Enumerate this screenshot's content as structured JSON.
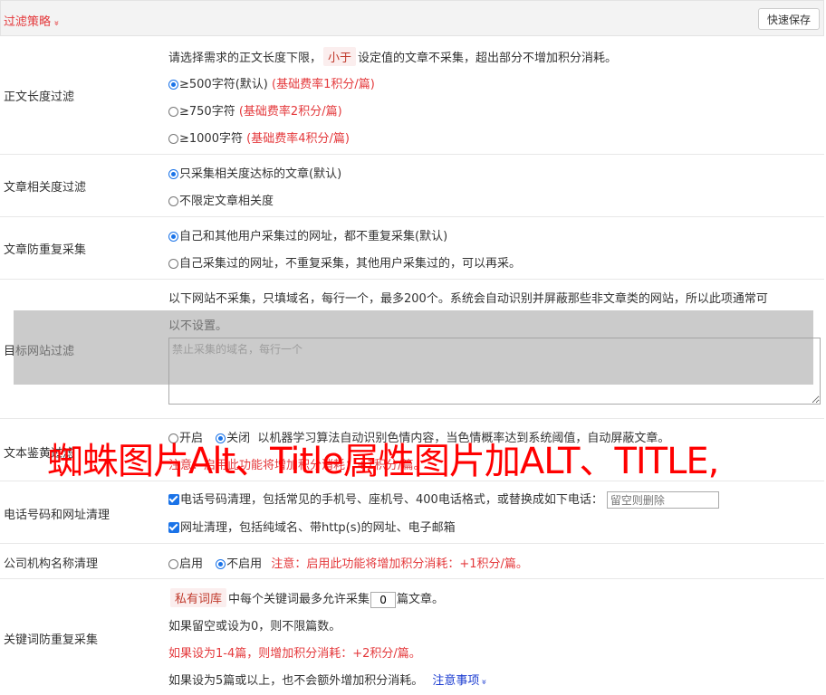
{
  "header": {
    "title": "过滤策略",
    "chevron": "»",
    "save_label": "快速保存"
  },
  "length_filter": {
    "label": "正文长度过滤",
    "desc_pre": "请选择需求的正文长度下限，",
    "desc_tag": "小于",
    "desc_post": "设定值的文章不采集，超出部分不增加积分消耗。",
    "options": [
      {
        "text": "≥500字符(默认)",
        "note": "(基础费率1积分/篇)",
        "checked": true
      },
      {
        "text": "≥750字符",
        "note": "(基础费率2积分/篇)",
        "checked": false
      },
      {
        "text": "≥1000字符",
        "note": "(基础费率4积分/篇)",
        "checked": false
      }
    ]
  },
  "relevance": {
    "label": "文章相关度过滤",
    "options": [
      {
        "text": "只采集相关度达标的文章(默认)",
        "checked": true
      },
      {
        "text": "不限定文章相关度",
        "checked": false
      }
    ]
  },
  "dedupe": {
    "label": "文章防重复采集",
    "options": [
      {
        "text": "自己和其他用户采集过的网址，都不重复采集(默认)",
        "checked": true
      },
      {
        "text": "自己采集过的网址，不重复采集，其他用户采集过的，可以再采。",
        "checked": false
      }
    ]
  },
  "site_filter": {
    "label": "目标网站过滤",
    "desc_line1": "以下网站不采集，只填域名，每行一个，最多200个。系统会自动识别并屏蔽那些非文章类的网站，所以此项通常可",
    "desc_line2": "以不设置。",
    "placeholder": "禁止采集的域名，每行一个"
  },
  "text_check": {
    "label": "文本鉴黄过滤",
    "on_label": "开启",
    "off_label": "关闭",
    "desc": "以机器学习算法自动识别色情内容，当色情概率达到系统阈值，自动屏蔽文章。",
    "warn": "注意：启用此功能将增加积分消耗：+1积分/篇。"
  },
  "phone_url": {
    "label": "电话号码和网址清理",
    "phone_text": "电话号码清理，包括常见的手机号、座机号、400电话格式，或替换成如下电话：",
    "phone_placeholder": "留空则删除",
    "url_text": "网址清理，包括纯域名、带http(s)的网址、电子邮箱"
  },
  "org_clean": {
    "label": "公司机构名称清理",
    "on_label": "启用",
    "off_label": "不启用",
    "warn": "注意：启用此功能将增加积分消耗：+1积分/篇。"
  },
  "keyword_dedupe": {
    "label": "关键词防重复采集",
    "tag": "私有词库",
    "text_pre": "中每个关键词最多允许采集",
    "value": "0",
    "text_post": "篇文章。",
    "line2": "如果留空或设为0，则不限篇数。",
    "line3": "如果设为1-4篇，则增加积分消耗：+2积分/篇。",
    "line4": "如果设为5篇或以上，也不会额外增加积分消耗。",
    "note_link": "注意事项",
    "note_chevron": "»"
  },
  "watermark": "蜘蛛图片Alt、Title属性图片加ALT、TITLE,",
  "colors": {
    "accent_red": "#e4393c",
    "link_blue": "#1a3bd0",
    "control_blue": "#1a73e8"
  }
}
